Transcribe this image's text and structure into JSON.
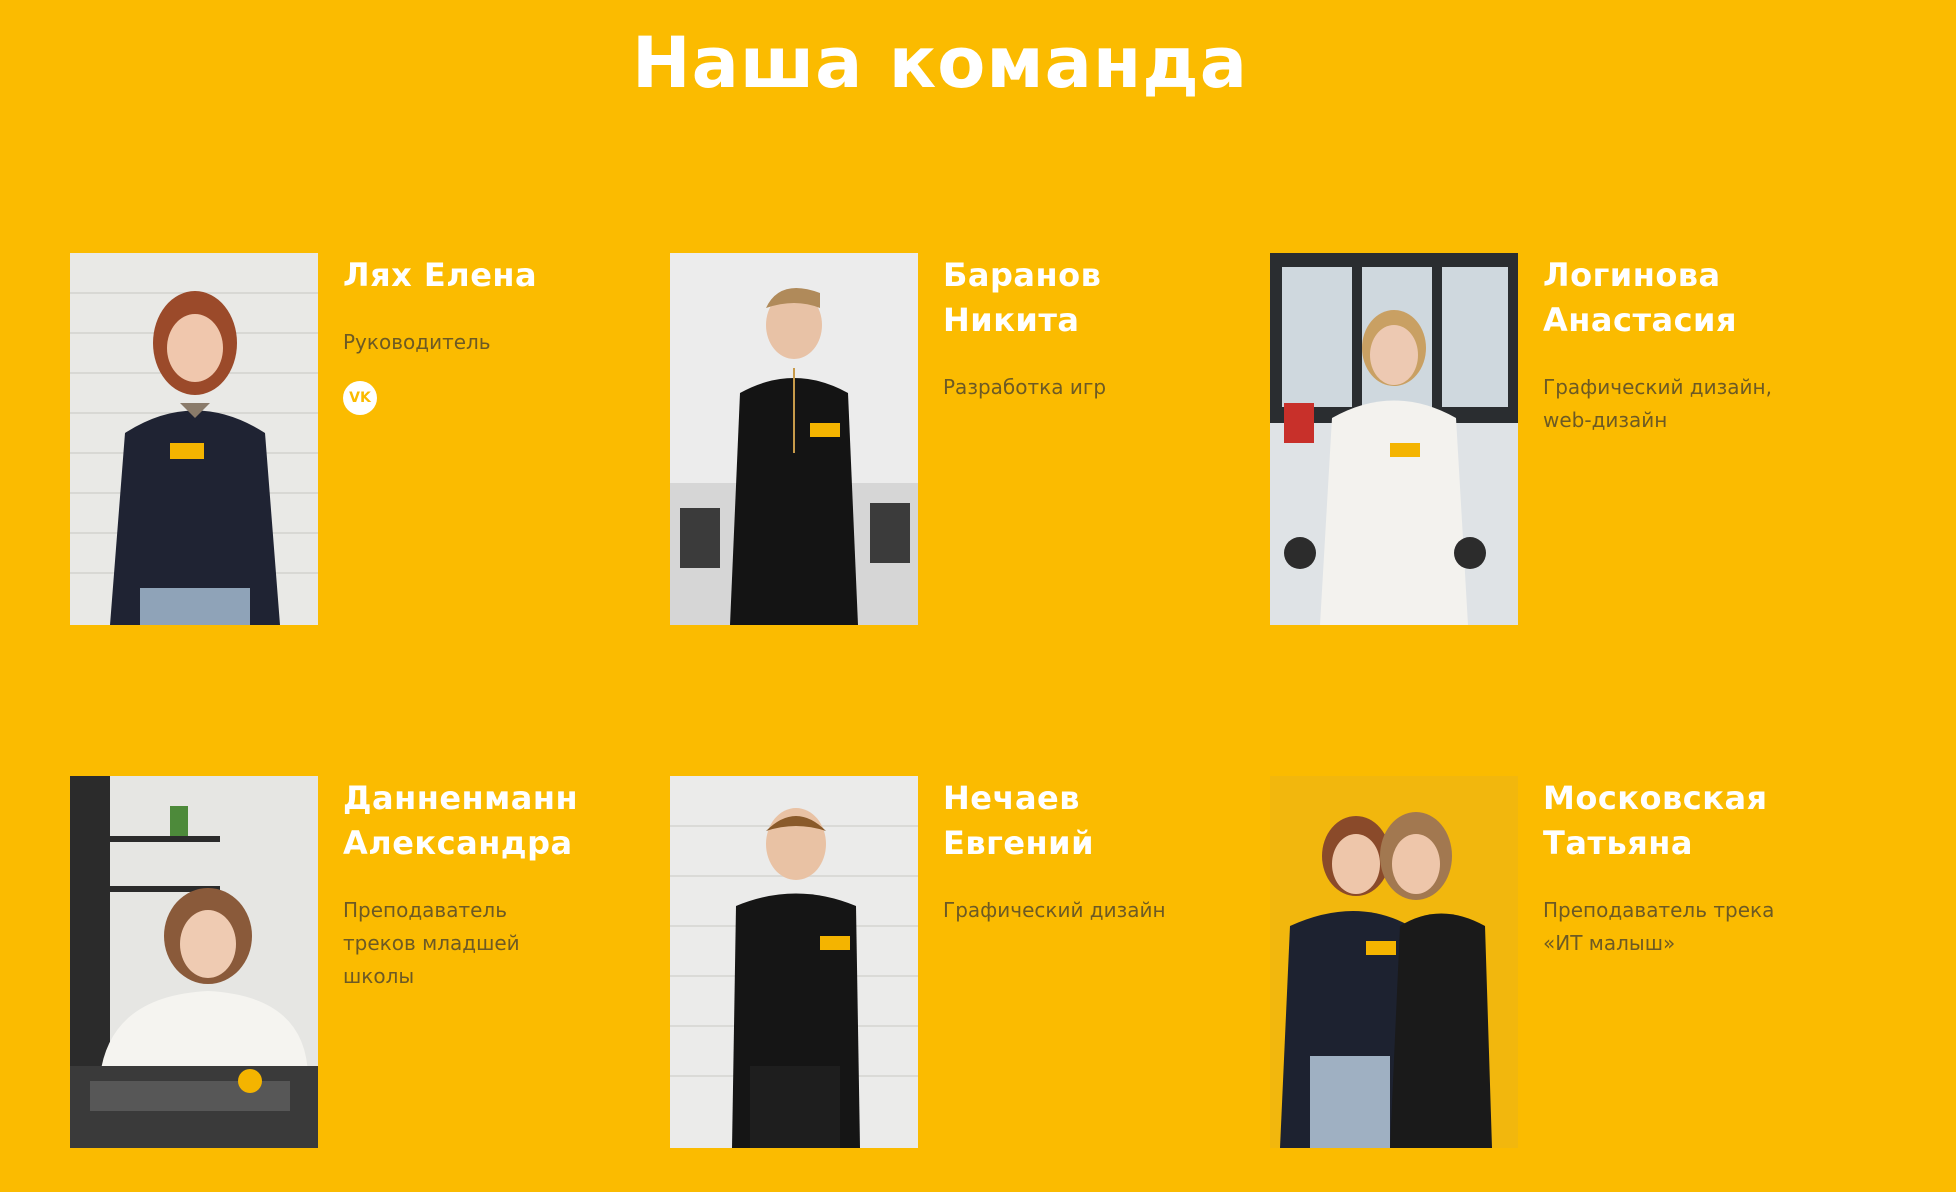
{
  "section": {
    "title": "Наша команда"
  },
  "team": [
    {
      "name_line1": "Лях Елена",
      "name_line2": "",
      "role_line1": "Руководитель",
      "role_line2": "",
      "role_line3": "",
      "social_label": "VK",
      "social_icon": "vk-icon"
    },
    {
      "name_line1": "Баранов",
      "name_line2": "Никита",
      "role_line1": "Разработка игр",
      "role_line2": "",
      "role_line3": ""
    },
    {
      "name_line1": "Логинова",
      "name_line2": "Анастасия",
      "role_line1": "Графический дизайн,",
      "role_line2": "web-дизайн",
      "role_line3": ""
    },
    {
      "name_line1": "Данненманн",
      "name_line2": "Александра",
      "role_line1": "Преподаватель",
      "role_line2": "треков младшей",
      "role_line3": "школы"
    },
    {
      "name_line1": "Нечаев",
      "name_line2": "Евгений",
      "role_line1": "Графический дизайн",
      "role_line2": "",
      "role_line3": ""
    },
    {
      "name_line1": "Московская",
      "name_line2": "Татьяна",
      "role_line1": "Преподаватель трека",
      "role_line2": "«ИТ малыш»",
      "role_line3": ""
    }
  ],
  "colors": {
    "background": "#FBBB00",
    "heading": "#FFFFFF",
    "role_text": "#6D5A24"
  }
}
